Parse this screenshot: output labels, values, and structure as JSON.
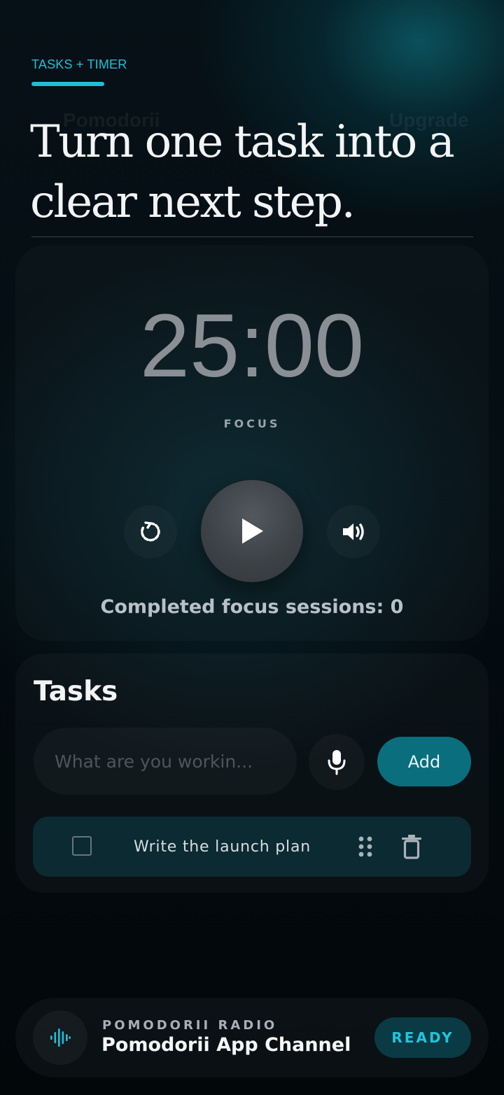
{
  "theme": {
    "accent": "#1fc0d6",
    "primary_button": "#0a6e7d",
    "task_row_bg": "#0b2a31",
    "background": "#03080c"
  },
  "background_header": {
    "app_name": "Pomodorii",
    "upgrade_label": "Upgrade"
  },
  "hero": {
    "eyebrow": "TASKS + TIMER",
    "headline": "Turn one task into a clear next step."
  },
  "timer": {
    "time": "25:00",
    "mode": "FOCUS",
    "reset_icon": "restart-icon",
    "play_icon": "play-icon",
    "sound_icon": "volume-icon",
    "sessions_text": "Completed focus sessions: 0"
  },
  "tasks": {
    "title": "Tasks",
    "input_placeholder": "What are you workin...",
    "input_value": "",
    "mic_icon": "microphone-icon",
    "add_label": "Add",
    "items": [
      {
        "label": "Write the launch plan",
        "checked": false
      }
    ]
  },
  "radio": {
    "eyebrow": "POMODORII RADIO",
    "channel": "Pomodorii App Channel",
    "status": "READY",
    "icon": "audio-wave-icon"
  }
}
